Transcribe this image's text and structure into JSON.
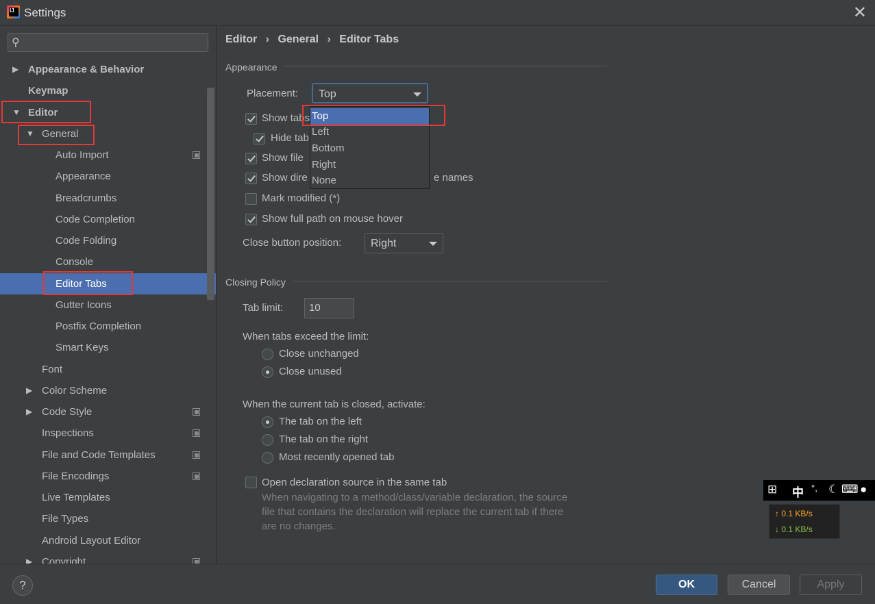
{
  "window": {
    "title": "Settings",
    "close_glyph": "✕"
  },
  "search": {
    "placeholder": "",
    "icon": "search-icon"
  },
  "tree": [
    {
      "label": "Appearance & Behavior",
      "arrow": "▶",
      "bold": true
    },
    {
      "label": "Keymap",
      "arrow": "",
      "bold": true
    },
    {
      "label": "Editor",
      "arrow": "▼",
      "bold": true
    },
    {
      "label": "General",
      "arrow": "▼"
    },
    {
      "label": "Auto Import",
      "copy": true
    },
    {
      "label": "Appearance"
    },
    {
      "label": "Breadcrumbs"
    },
    {
      "label": "Code Completion"
    },
    {
      "label": "Code Folding"
    },
    {
      "label": "Console"
    },
    {
      "label": "Editor Tabs",
      "selected": true
    },
    {
      "label": "Gutter Icons"
    },
    {
      "label": "Postfix Completion"
    },
    {
      "label": "Smart Keys"
    },
    {
      "label": "Font"
    },
    {
      "label": "Color Scheme",
      "arrow": "▶"
    },
    {
      "label": "Code Style",
      "arrow": "▶",
      "copy": true
    },
    {
      "label": "Inspections",
      "copy": true
    },
    {
      "label": "File and Code Templates",
      "copy": true
    },
    {
      "label": "File Encodings",
      "copy": true
    },
    {
      "label": "Live Templates"
    },
    {
      "label": "File Types"
    },
    {
      "label": "Android Layout Editor"
    },
    {
      "label": "Copyright",
      "arrow": "▶",
      "copy": true
    }
  ],
  "breadcrumb": {
    "a": "Editor",
    "b": "General",
    "c": "Editor Tabs",
    "sep": "›"
  },
  "appearance": {
    "section": "Appearance",
    "placement_label": "Placement:",
    "placement_value": "Top",
    "show_tabs_label": "Show tabs",
    "hide_tab_label": "Hide tab",
    "show_file_label": "Show file",
    "show_dir_label": "Show dire",
    "show_dir_tail": "e names",
    "mark_modified_label": "Mark modified (*)",
    "full_path_label": "Show full path on mouse hover",
    "close_btn_label": "Close button position:",
    "close_btn_value": "Right"
  },
  "placement_options": [
    "Top",
    "Left",
    "Bottom",
    "Right",
    "None"
  ],
  "closing": {
    "section": "Closing Policy",
    "tab_limit_label": "Tab limit:",
    "tab_limit_value": "10",
    "exceed_label": "When tabs exceed the limit:",
    "close_unchanged": "Close unchanged",
    "close_unused": "Close unused",
    "activate_label": "When the current tab is closed, activate:",
    "tab_left": "The tab on the left",
    "tab_right": "The tab on the right",
    "most_recent": "Most recently opened tab",
    "open_decl_label": "Open declaration source in the same tab",
    "hint_1": "When navigating to a method/class/variable declaration, the source",
    "hint_2": "file that contains the declaration will replace the current tab if there",
    "hint_3": "are no changes."
  },
  "buttons": {
    "help": "?",
    "ok": "OK",
    "cancel": "Cancel",
    "apply": "Apply"
  },
  "tray": {
    "ime": "中",
    "up": "↑ 0.1 KB/s",
    "down": "↓ 0.1 KB/s"
  },
  "colors": {
    "selection": "#4b6eaf",
    "highlight_box": "#e53935",
    "background": "#3c3f41"
  }
}
